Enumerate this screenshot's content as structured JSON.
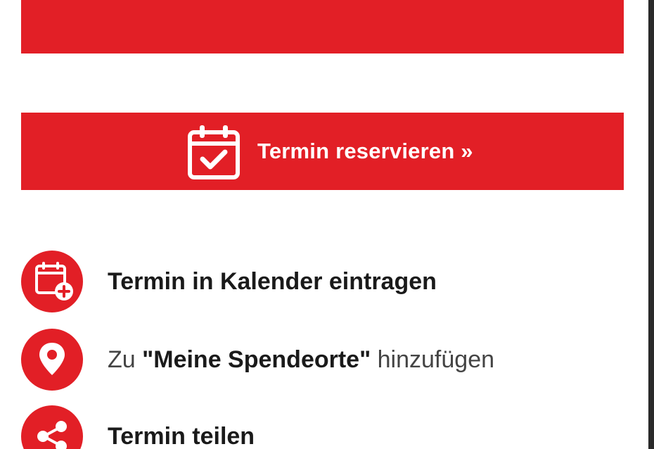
{
  "colors": {
    "accent": "#e21f26",
    "text": "#1a1a1a",
    "text_light": "#444444",
    "background": "#ffffff"
  },
  "reserve_button": {
    "label": "Termin reservieren »",
    "icon": "calendar-check-icon"
  },
  "actions": [
    {
      "icon": "calendar-plus-icon",
      "label": "Termin in Kalender eintragen"
    },
    {
      "icon": "map-pin-icon",
      "label_prefix": "Zu ",
      "label_bold": "\"Meine Spendeorte\"",
      "label_suffix": " hinzufügen"
    },
    {
      "icon": "share-icon",
      "label": "Termin teilen"
    }
  ]
}
